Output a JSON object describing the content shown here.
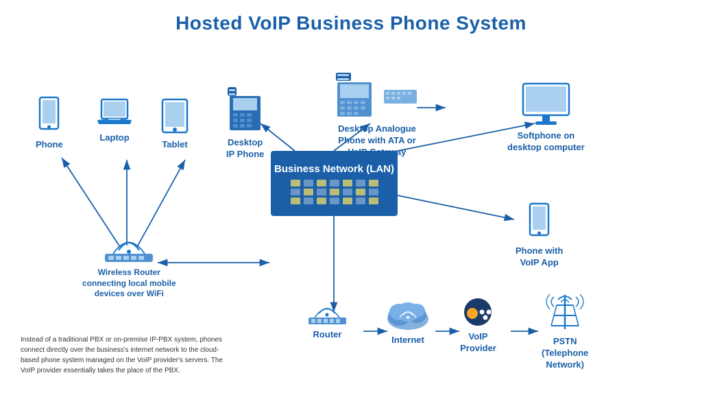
{
  "title": "Hosted VoIP Business Phone System",
  "devices": {
    "phone": {
      "label": "Phone"
    },
    "laptop": {
      "label": "Laptop"
    },
    "tablet": {
      "label": "Tablet"
    },
    "desktopIP": {
      "label": "Desktop\nIP Phone"
    },
    "analoguePhone": {
      "label": "Desktop Analogue\nPhone with ATA or\nVoIP Gateway"
    },
    "softphone": {
      "label": "Softphone on\ndesktop computer"
    },
    "voipApp": {
      "label": "Phone with\nVoIP App"
    },
    "wirelessRouter": {
      "label": "Wireless Router\nconnecting local mobile\ndevices over WiFi"
    },
    "businessNetwork": {
      "label1": "Business Network (LAN)"
    },
    "router": {
      "label": "Router"
    },
    "internet": {
      "label": "Internet"
    },
    "voipProvider": {
      "label": "VoIP\nProvider"
    },
    "pstn": {
      "label": "PSTN\n(Telephone\nNetwork)"
    }
  },
  "infoText": "Instead of a traditional PBX or on-premise IP-PBX system, phones connect directly over the business's internet network to the cloud-based phone system managed on the VoIP provider's servers. The VoIP provider essentially takes the place of the PBX."
}
